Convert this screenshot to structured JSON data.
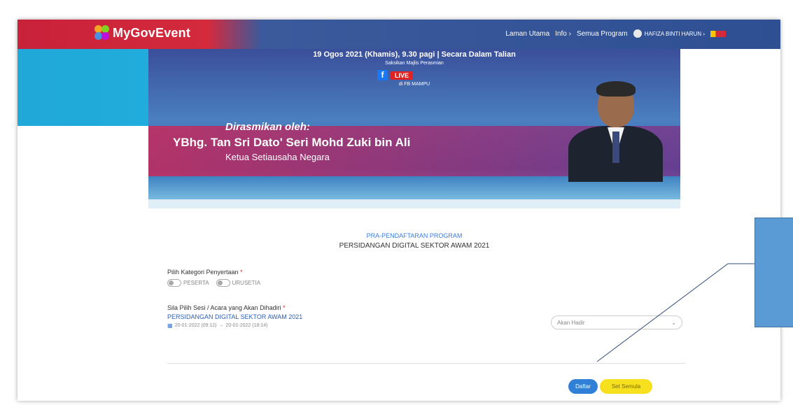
{
  "navbar": {
    "logo_text": "MyGovEvent",
    "links": [
      "Laman Utama",
      "Info ›",
      "Semua Program"
    ],
    "user_name": "HAFIZA BINTI HARUN ›",
    "colors": {
      "red": "#c8213a",
      "blue": "#2f4f93",
      "cyan": "#20a8d8"
    }
  },
  "banner": {
    "date_line": "19 Ogos 2021 (Khamis), 9.30 pagi | Secara Dalam Talian",
    "witness_line": "Saksikan Majlis Perasmian",
    "live_label": "LIVE",
    "fb_line": "di FB MAMPU",
    "officiated_label": "Dirasmikan oleh:",
    "officiant_name": "YBhg. Tan Sri Dato' Seri Mohd Zuki bin Ali",
    "officiant_role": "Ketua Setiausaha Negara"
  },
  "form": {
    "heading": "PRA-PENDAFTARAN PROGRAM",
    "title": "PERSIDANGAN DIGITAL SEKTOR AWAM 2021",
    "category_label": "Pilih Kategori Penyertaan",
    "options": [
      "PESERTA",
      "URUSETIA"
    ],
    "session_label": "Sila Pilih Sesi / Acara yang Akan Dihadiri",
    "session_name": "PERSIDANGAN DIGITAL SEKTOR AWAM 2021",
    "session_start": "20-01-2022 (09:12)",
    "session_end": "20-01-2022 (18:14)",
    "attendance_value": "Akan Hadir",
    "register_button": "Daftar",
    "reset_button": "Set Semula"
  }
}
